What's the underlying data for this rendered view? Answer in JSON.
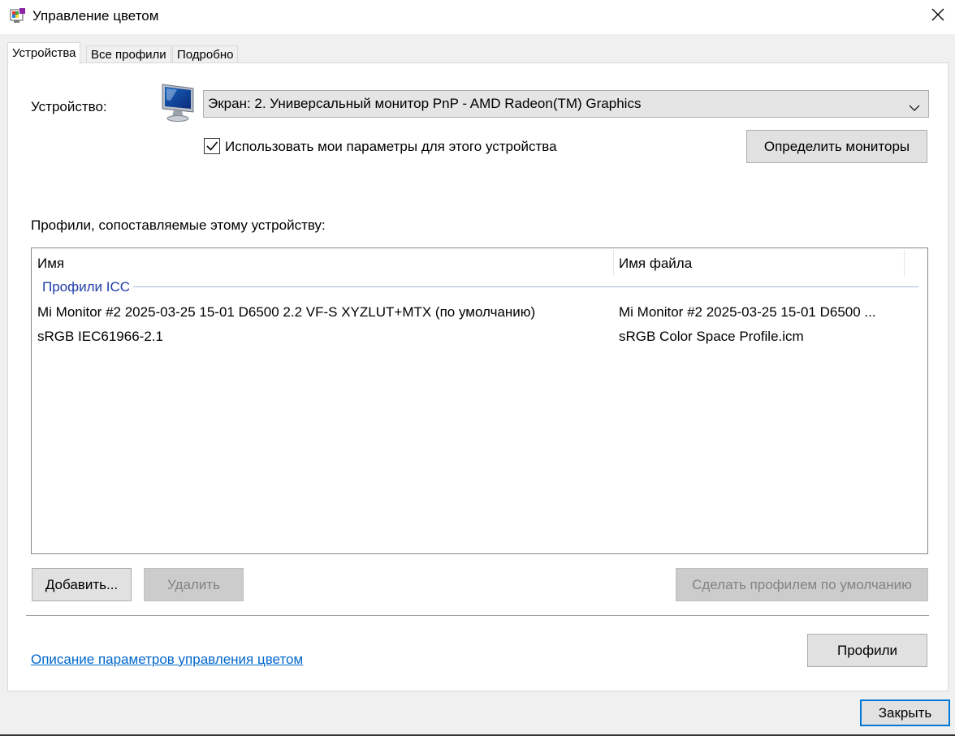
{
  "window": {
    "title": "Управление цветом",
    "app_icon": "color-management-icon",
    "close_icon": "close-icon"
  },
  "tabs": [
    {
      "label": "Устройства",
      "active": true
    },
    {
      "label": "Все профили",
      "active": false
    },
    {
      "label": "Подробно",
      "active": false
    }
  ],
  "device": {
    "label": "Устройство:",
    "icon": "monitor-icon",
    "selected": "Экран: 2. Универсальный монитор PnP - AMD Radeon(TM) Graphics",
    "use_my_settings_label": "Использовать мои параметры для этого устройства",
    "use_my_settings_checked": true,
    "identify_button": "Определить мониторы"
  },
  "profiles": {
    "label": "Профили, сопоставляемые этому устройству:",
    "columns": [
      "Имя",
      "Имя файла"
    ],
    "group": "Профили ICC",
    "rows": [
      {
        "name": "Mi Monitor #2 2025-03-25 15-01 D6500 2.2 VF-S XYZLUT+MTX (по умолчанию)",
        "file": "Mi Monitor #2 2025-03-25 15-01 D6500 ..."
      },
      {
        "name": "sRGB IEC61966-2.1",
        "file": "sRGB Color Space Profile.icm"
      }
    ]
  },
  "actions": {
    "add": "Добавить...",
    "remove": "Удалить",
    "set_default": "Сделать профилем по умолчанию",
    "profiles": "Профили"
  },
  "footer": {
    "link": "Описание параметров управления цветом",
    "close": "Закрыть"
  },
  "colors": {
    "accent": "#0078d7",
    "link": "#0066cc",
    "group_header": "#1e3da8"
  }
}
